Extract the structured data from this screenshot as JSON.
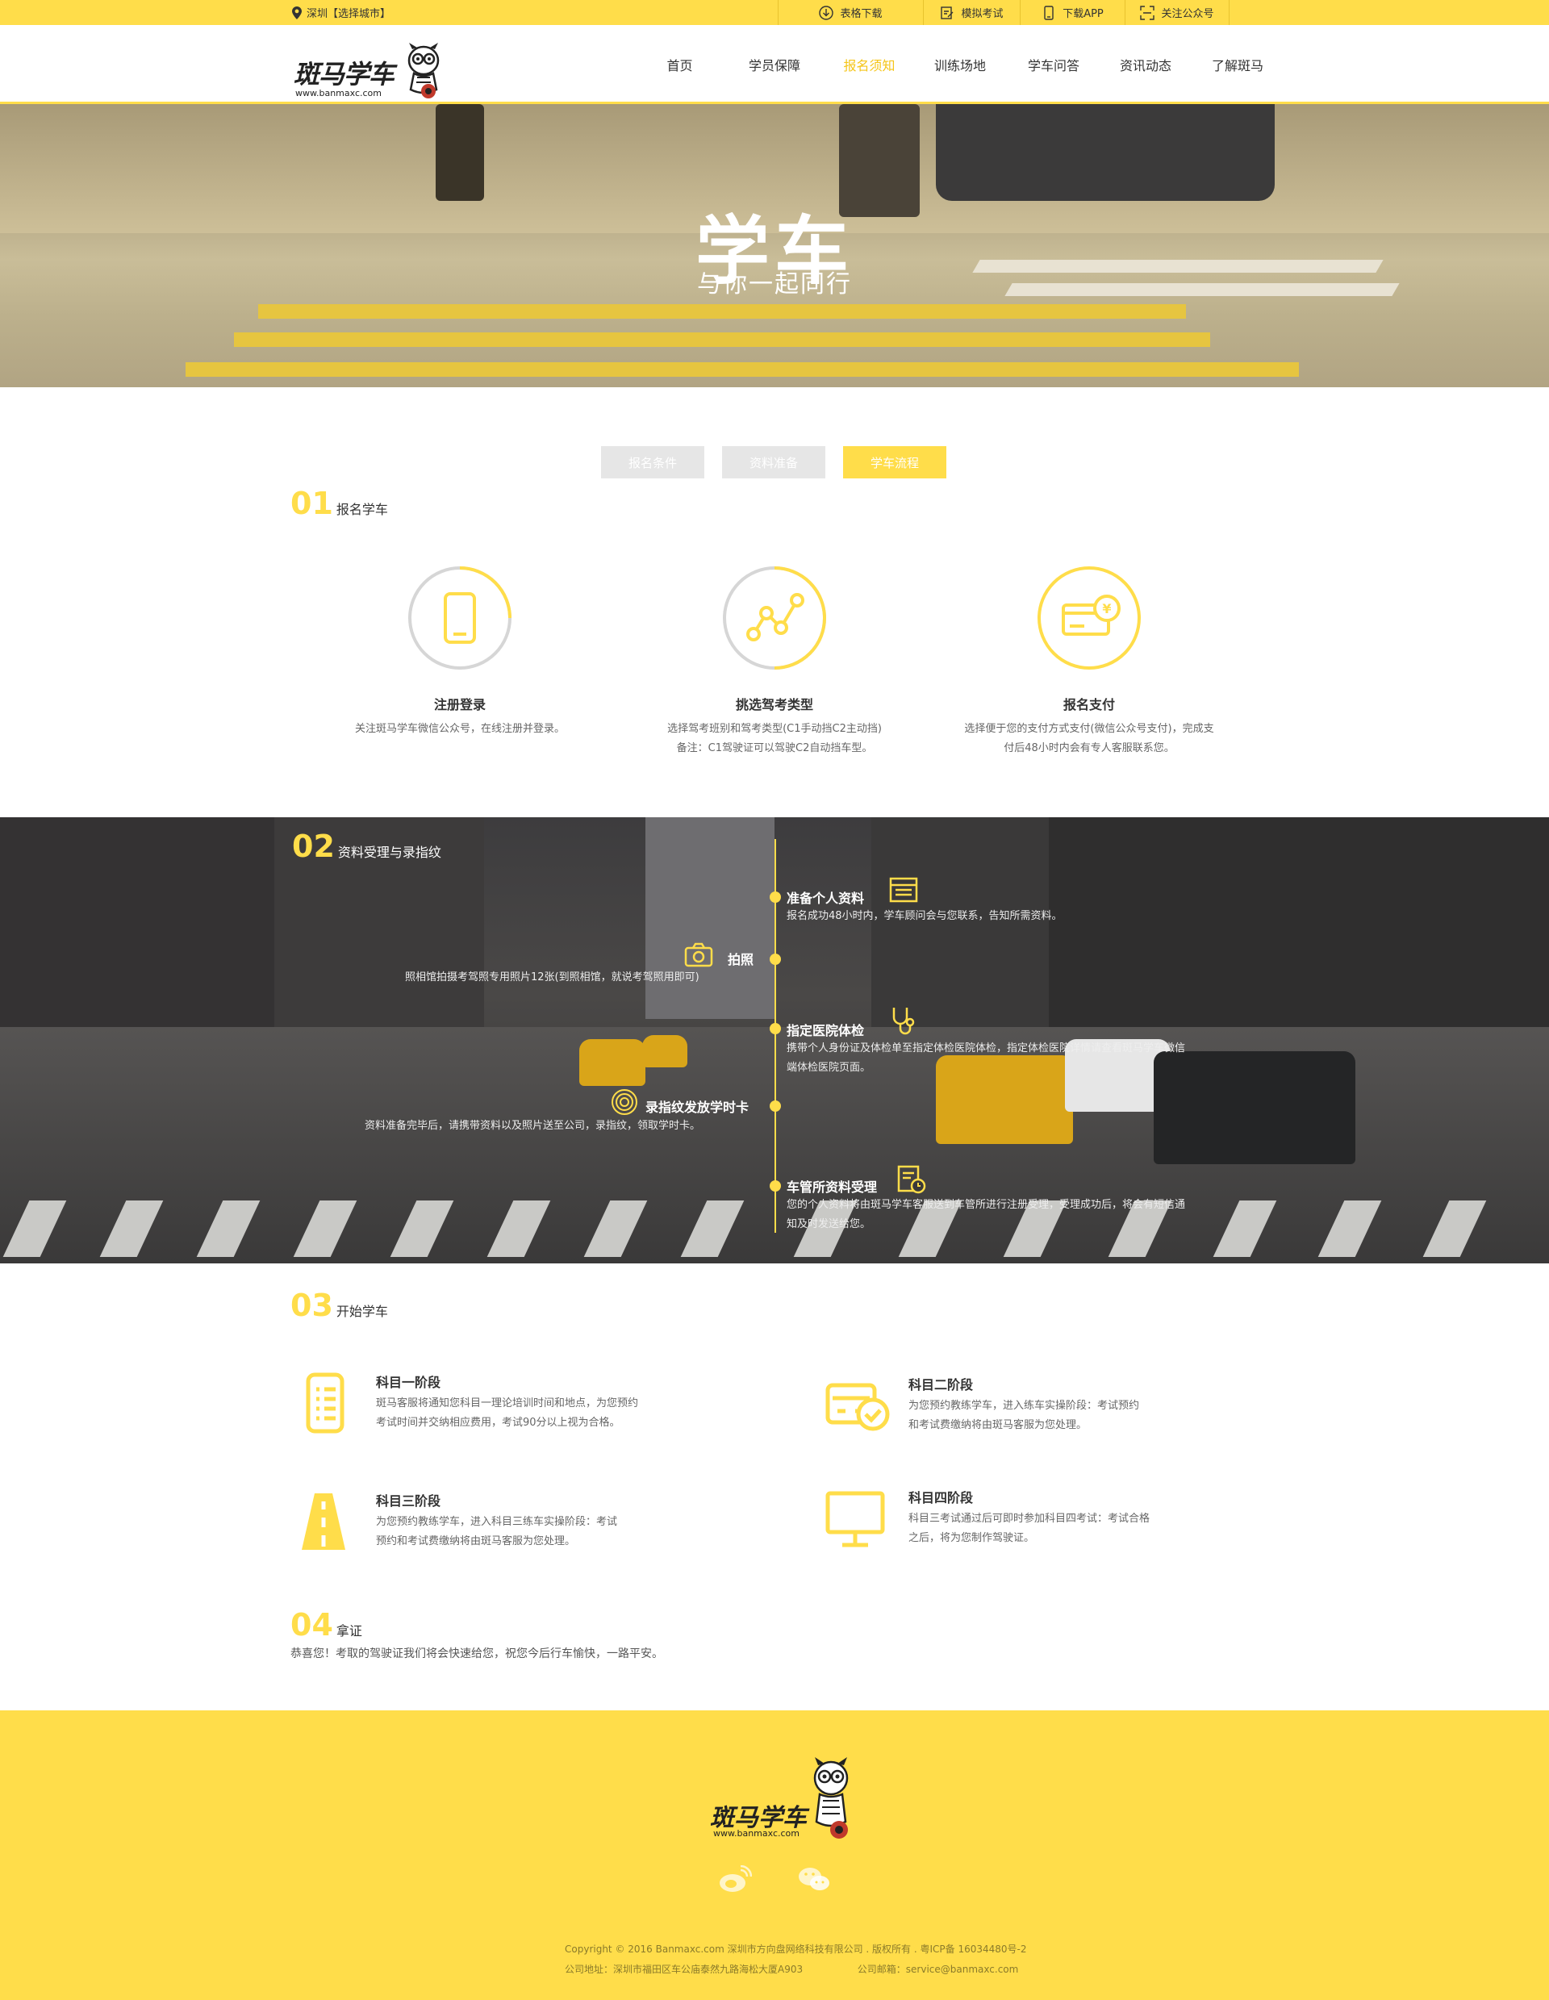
{
  "topbar": {
    "city": "深圳【选择城市】",
    "links": [
      {
        "label": "表格下载",
        "icon": "download-icon"
      },
      {
        "label": "模拟考试",
        "icon": "exam-icon"
      },
      {
        "label": "下载APP",
        "icon": "mobile-icon"
      },
      {
        "label": "关注公众号",
        "icon": "qrcode-icon"
      }
    ]
  },
  "header": {
    "logo_text": "斑马学车",
    "logo_url": "www.banmaxc.com",
    "nav": [
      "首页",
      "学员保障",
      "报名须知",
      "训练场地",
      "学车问答",
      "资讯动态",
      "了解斑马"
    ],
    "active_nav": "报名须知"
  },
  "hero": {
    "title": "学车",
    "subtitle": "与你一起同行"
  },
  "tabs": {
    "items": [
      "报名条件",
      "资料准备",
      "学车流程"
    ],
    "active": "学车流程"
  },
  "step1": {
    "num": "01",
    "title": "报名学车",
    "items": [
      {
        "title": "注册登录",
        "desc": [
          "关注斑马学车微信公众号，在线注册并登录。"
        ],
        "icon": "phone-icon"
      },
      {
        "title": "挑选驾考类型",
        "desc": [
          "选择驾考班别和驾考类型(C1手动挡C2主动挡)",
          "备注：C1驾驶证可以驾驶C2自动挡车型。"
        ],
        "icon": "share-graph-icon"
      },
      {
        "title": "报名支付",
        "desc": [
          "选择便于您的支付方式支付(微信公众号支付)，完成支",
          "付后48小时内会有专人客服联系您。"
        ],
        "icon": "payment-card-icon"
      }
    ]
  },
  "step2": {
    "num": "02",
    "title": "资料受理与录指纹",
    "items": [
      {
        "title": "准备个人资料",
        "desc": [
          "报名成功48小时内，学车顾问会与您联系，告知所需资料。"
        ],
        "icon": "document-list-icon"
      },
      {
        "title": "拍照",
        "desc": [
          "照相馆拍摄考驾照专用照片12张(到照相馆，就说考驾照用即可)"
        ],
        "icon": "camera-icon"
      },
      {
        "title": "指定医院体检",
        "desc": [
          "携带个人身份证及体检单至指定体检医院体检，指定体检医院详情请查看斑马学车微信",
          "端体检医院页面。"
        ],
        "icon": "stethoscope-icon"
      },
      {
        "title": "录指纹发放学时卡",
        "desc": [
          "资料准备完毕后，请携带资料以及照片送至公司，录指纹，领取学时卡。"
        ],
        "icon": "fingerprint-icon"
      },
      {
        "title": "车管所资料受理",
        "desc": [
          "您的个人资料将由斑马学车客服送到车管所进行注册受理，受理成功后，将会有短信通",
          "知及时发送给您。"
        ],
        "icon": "clipboard-clock-icon"
      }
    ]
  },
  "step3": {
    "num": "03",
    "title": "开始学车",
    "stages": [
      {
        "title": "科目一阶段",
        "desc": [
          "斑马客服将通知您科目一理论培训时间和地点，为您预约",
          "考试时间并交纳相应费用，考试90分以上视为合格。"
        ],
        "icon": "list-doc-icon"
      },
      {
        "title": "科目二阶段",
        "desc": [
          "为您预约教练学车，进入练车实操阶段：考试预约",
          "和考试费缴纳将由斑马客服为您处理。"
        ],
        "icon": "car-check-icon"
      },
      {
        "title": "科目三阶段",
        "desc": [
          "为您预约教练学车，进入科目三练车实操阶段：考试",
          "预约和考试费缴纳将由斑马客服为您处理。"
        ],
        "icon": "road-icon"
      },
      {
        "title": "科目四阶段",
        "desc": [
          "科目三考试通过后可即时参加科目四考试：考试合格",
          "之后，将为您制作驾驶证。"
        ],
        "icon": "monitor-icon"
      }
    ]
  },
  "step4": {
    "num": "04",
    "title": "拿证",
    "desc": "恭喜您！考取的驾驶证我们将会快速给您，祝您今后行车愉快，一路平安。"
  },
  "footer": {
    "logo_text": "斑马学车",
    "logo_url": "www.banmaxc.com",
    "social": [
      "weibo-icon",
      "wechat-icon"
    ],
    "copyright": "Copyright © 2016 Banmaxc.com    深圳市方向盘网络科技有限公司 . 版权所有 . 粤ICP备 16034480号-2",
    "address": "公司地址：深圳市福田区车公庙泰然九路海松大厦A903",
    "email": "公司邮箱：service@banmaxc.com"
  },
  "colors": {
    "accent": "#ffdd4a",
    "active_text": "#f5c518"
  }
}
